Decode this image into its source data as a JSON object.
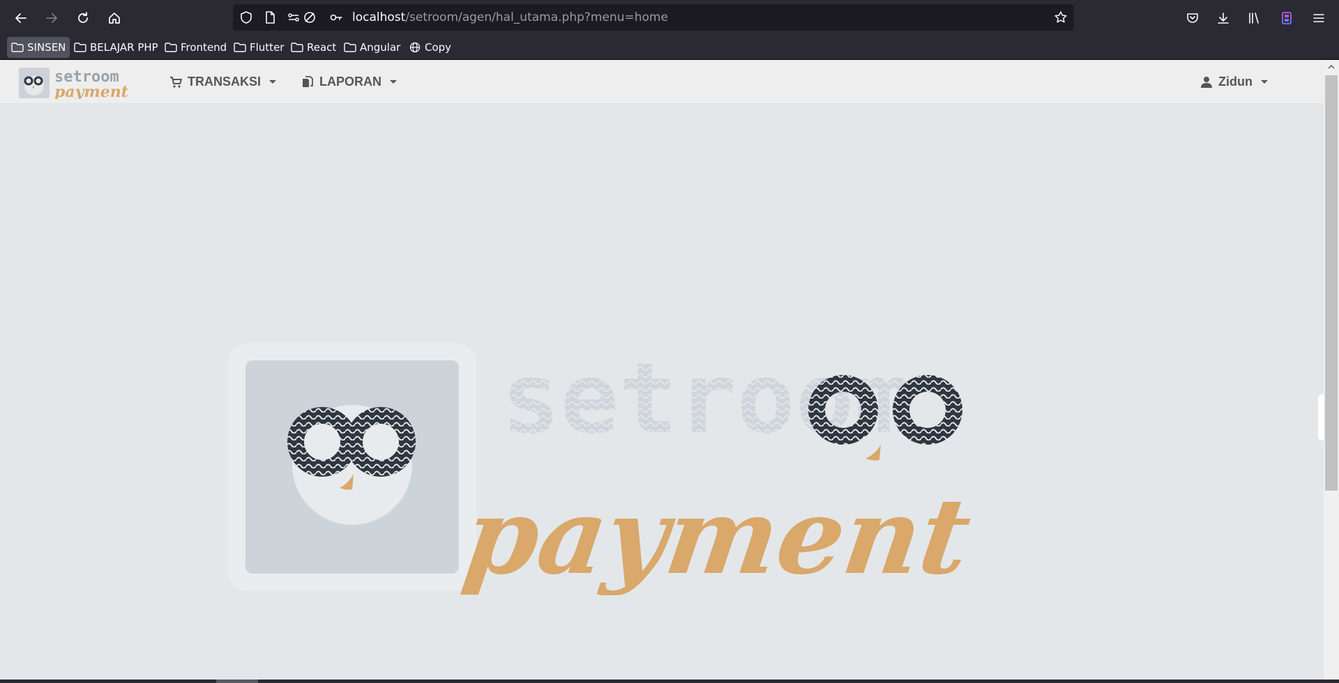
{
  "browser": {
    "url_host": "localhost",
    "url_path": "/setroom/agen/hal_utama.php?menu=home",
    "bookmarks": [
      {
        "label": "SINSEN",
        "icon": "folder-icon",
        "active": true
      },
      {
        "label": "BELAJAR PHP",
        "icon": "folder-icon"
      },
      {
        "label": "Frontend",
        "icon": "folder-icon"
      },
      {
        "label": "Flutter",
        "icon": "folder-icon"
      },
      {
        "label": "React",
        "icon": "folder-icon"
      },
      {
        "label": "Angular",
        "icon": "folder-icon"
      },
      {
        "label": "Copy",
        "icon": "globe-icon"
      }
    ]
  },
  "navbar": {
    "brand_line1": "setroom",
    "brand_line2": "payment",
    "menus": [
      {
        "label": "TRANSAKSI",
        "icon": "cart-icon"
      },
      {
        "label": "LAPORAN",
        "icon": "files-icon"
      }
    ],
    "user": {
      "label": "Zidun",
      "icon": "user-icon"
    }
  },
  "hero": {
    "word1": "setroom",
    "word2": "payment"
  },
  "colors": {
    "accent": "#d9a86a",
    "dark": "#2f3740",
    "page_bg": "#e3e7ea",
    "sidebar_tab_icon": "#2f80c0"
  }
}
